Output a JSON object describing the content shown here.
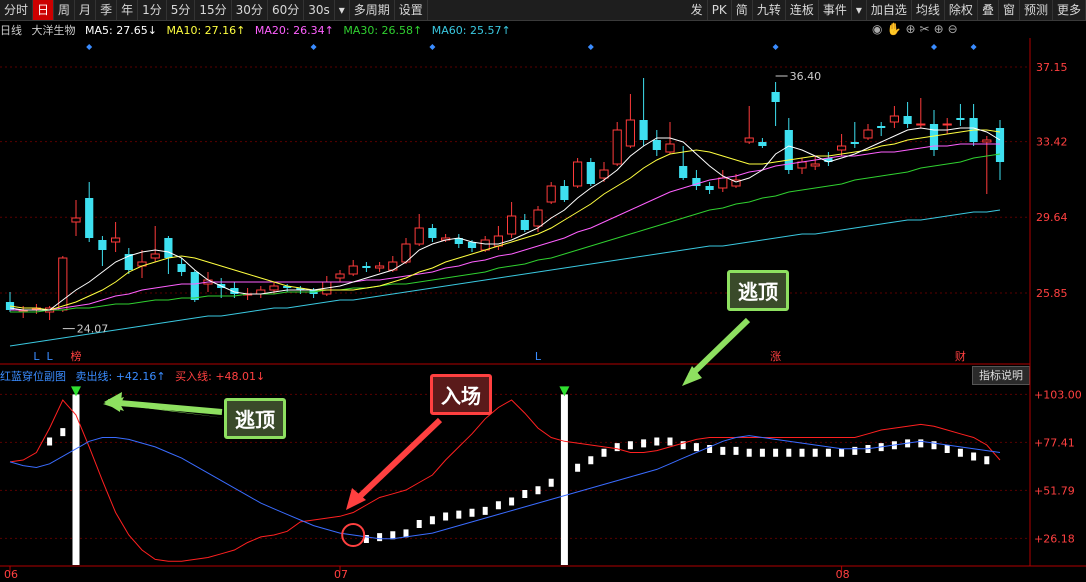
{
  "toolbar": {
    "left_items": [
      "分时",
      "日",
      "周",
      "月",
      "季",
      "年",
      "1分",
      "5分",
      "15分",
      "30分",
      "60分",
      "30s",
      "▾",
      "多周期",
      "设置"
    ],
    "active_index": 1,
    "right_items": [
      "发",
      "PK",
      "简",
      "九转",
      "连板",
      "事件",
      "▾",
      "加自选",
      "均线",
      "除权",
      "叠",
      "窗",
      "预测",
      "更多"
    ]
  },
  "info": {
    "period": "日线",
    "name": "大洋生物",
    "ma5": "MA5: 27.65↓",
    "ma10": "MA10: 27.16↑",
    "ma20": "MA20: 26.34↑",
    "ma30": "MA30: 26.58↑",
    "ma60": "MA60: 25.57↑"
  },
  "sub": {
    "title": "红蓝穿位副图",
    "sell": "卖出线: +42.16↑",
    "buy": "买入线: +48.01↓",
    "indicator_button": "指标说明"
  },
  "annotations": {
    "escape_top_1": "逃顶",
    "escape_top_2": "逃顶",
    "entry": "入场",
    "high_label": "36.40",
    "low_label": "24.07",
    "markers": [
      "L",
      "L",
      "榜",
      "L",
      "涨",
      "财"
    ]
  },
  "x_labels": [
    "06",
    "07",
    "08"
  ],
  "colors": {
    "up": "#ff3b3b",
    "down": "#3ee0f0",
    "ma5": "#ffffff",
    "ma10": "#ffff40",
    "ma20": "#ff60ff",
    "ma30": "#30d030",
    "ma60": "#3ac8e0",
    "red_line": "#ff2020",
    "blue_line": "#3a6cff",
    "callout_green": "#8ee060",
    "callout_red": "#ff4040"
  },
  "chart_data": [
    {
      "type": "candlestick",
      "title": "大洋生物 日线",
      "y_ticks": [
        37.15,
        33.42,
        29.64,
        25.85
      ],
      "ylim": [
        23.0,
        38.5
      ],
      "candles": [
        [
          25.4,
          25.0,
          25.9,
          24.9
        ],
        [
          25.0,
          25.0,
          25.2,
          24.6
        ],
        [
          25.1,
          25.1,
          25.3,
          24.8
        ],
        [
          24.9,
          25.1,
          25.2,
          24.5
        ],
        [
          25.0,
          27.6,
          27.7,
          24.9
        ],
        [
          29.4,
          29.6,
          30.5,
          28.7
        ],
        [
          30.6,
          28.6,
          31.4,
          28.4
        ],
        [
          28.5,
          28.0,
          28.7,
          27.2
        ],
        [
          28.4,
          28.6,
          29.4,
          27.9
        ],
        [
          27.8,
          27.0,
          28.1,
          26.8
        ],
        [
          27.2,
          27.4,
          28.0,
          26.6
        ],
        [
          27.6,
          27.8,
          29.2,
          27.4
        ],
        [
          28.6,
          27.6,
          28.7,
          26.8
        ],
        [
          27.3,
          26.9,
          27.6,
          26.7
        ],
        [
          26.9,
          25.5,
          27.0,
          25.4
        ],
        [
          26.3,
          26.5,
          26.9,
          25.9
        ],
        [
          26.3,
          26.1,
          26.6,
          25.6
        ],
        [
          26.1,
          25.8,
          26.4,
          25.6
        ],
        [
          25.8,
          25.8,
          26.1,
          25.5
        ],
        [
          25.8,
          26.0,
          26.2,
          25.6
        ],
        [
          26.0,
          26.2,
          26.4,
          25.8
        ],
        [
          26.2,
          26.1,
          26.3,
          25.9
        ],
        [
          26.1,
          26.0,
          26.2,
          25.8
        ],
        [
          26.0,
          25.8,
          26.1,
          25.6
        ],
        [
          25.8,
          26.4,
          26.7,
          25.7
        ],
        [
          26.6,
          26.8,
          27.0,
          26.4
        ],
        [
          26.8,
          27.2,
          27.5,
          26.7
        ],
        [
          27.2,
          27.1,
          27.4,
          26.9
        ],
        [
          27.1,
          27.2,
          27.4,
          26.9
        ],
        [
          27.0,
          27.4,
          27.7,
          26.9
        ],
        [
          27.4,
          28.3,
          28.6,
          27.3
        ],
        [
          28.3,
          29.1,
          29.8,
          28.2
        ],
        [
          29.1,
          28.6,
          29.3,
          28.4
        ],
        [
          28.5,
          28.6,
          28.8,
          28.4
        ],
        [
          28.6,
          28.3,
          28.8,
          28.1
        ],
        [
          28.4,
          28.1,
          28.5,
          27.9
        ],
        [
          28.0,
          28.5,
          28.7,
          27.9
        ],
        [
          28.2,
          28.7,
          29.2,
          28.0
        ],
        [
          28.8,
          29.7,
          30.4,
          28.6
        ],
        [
          29.5,
          29.0,
          29.8,
          28.9
        ],
        [
          29.2,
          30.0,
          30.2,
          28.9
        ],
        [
          30.4,
          31.2,
          31.4,
          30.3
        ],
        [
          31.2,
          30.5,
          31.5,
          30.4
        ],
        [
          31.2,
          32.4,
          32.6,
          31.1
        ],
        [
          32.4,
          31.3,
          32.6,
          31.2
        ],
        [
          31.6,
          32.0,
          32.4,
          31.4
        ],
        [
          32.3,
          34.0,
          34.4,
          32.2
        ],
        [
          33.2,
          34.5,
          35.8,
          33.1
        ],
        [
          34.5,
          33.5,
          36.6,
          33.2
        ],
        [
          33.5,
          33.0,
          34.0,
          32.7
        ],
        [
          32.9,
          33.3,
          34.4,
          32.8
        ],
        [
          32.2,
          31.6,
          33.2,
          31.5
        ],
        [
          31.6,
          31.2,
          32.0,
          31.0
        ],
        [
          31.2,
          31.0,
          31.4,
          30.8
        ],
        [
          31.1,
          31.6,
          32.0,
          30.9
        ],
        [
          31.2,
          31.5,
          31.8,
          31.1
        ],
        [
          33.4,
          33.6,
          35.2,
          33.3
        ],
        [
          33.4,
          33.2,
          33.6,
          33.1
        ],
        [
          35.9,
          35.4,
          36.4,
          34.2
        ],
        [
          34.0,
          32.0,
          34.6,
          31.8
        ],
        [
          32.1,
          32.4,
          32.6,
          31.8
        ],
        [
          32.2,
          32.3,
          32.7,
          32.0
        ],
        [
          32.6,
          32.4,
          32.9,
          32.2
        ],
        [
          33.0,
          33.2,
          33.8,
          32.7
        ],
        [
          33.4,
          33.3,
          34.4,
          33.1
        ],
        [
          33.6,
          34.0,
          34.3,
          33.5
        ],
        [
          34.2,
          34.1,
          34.4,
          33.7
        ],
        [
          34.4,
          34.7,
          35.2,
          34.1
        ],
        [
          34.7,
          34.3,
          35.4,
          34.1
        ],
        [
          34.3,
          34.3,
          35.6,
          34.1
        ],
        [
          34.3,
          33.0,
          35.0,
          32.7
        ],
        [
          34.3,
          34.3,
          34.6,
          33.8
        ],
        [
          34.6,
          34.5,
          35.3,
          34.2
        ],
        [
          34.6,
          33.4,
          35.3,
          33.2
        ],
        [
          33.4,
          33.5,
          33.7,
          30.8
        ],
        [
          34.1,
          32.4,
          34.5,
          31.5
        ]
      ],
      "ma5": [
        25.1,
        25.0,
        25.0,
        25.0,
        25.5,
        26.0,
        26.4,
        26.9,
        27.4,
        27.7,
        27.9,
        28.0,
        27.9,
        27.6,
        27.0,
        26.5,
        26.2,
        25.9,
        25.8,
        25.8,
        25.9,
        26.0,
        26.0,
        26.0,
        26.1,
        26.2,
        26.4,
        26.6,
        26.8,
        27.0,
        27.4,
        28.0,
        28.3,
        28.5,
        28.6,
        28.4,
        28.3,
        28.3,
        28.5,
        28.8,
        29.1,
        29.6,
        30.0,
        30.6,
        31.1,
        31.5,
        32.0,
        32.7,
        33.2,
        33.6,
        33.6,
        33.4,
        32.8,
        32.2,
        31.7,
        31.4,
        31.6,
        32.0,
        32.8,
        33.2,
        33.0,
        32.7,
        32.4,
        32.6,
        32.8,
        33.1,
        33.4,
        33.7,
        34.0,
        34.1,
        34.0,
        34.0,
        34.1,
        34.1,
        33.9,
        33.5
      ],
      "ma10": [
        25.2,
        25.1,
        25.1,
        25.0,
        25.2,
        25.4,
        25.7,
        26.0,
        26.4,
        26.9,
        27.2,
        27.4,
        27.6,
        27.7,
        27.6,
        27.4,
        27.2,
        27.0,
        26.8,
        26.6,
        26.4,
        26.2,
        26.1,
        26.0,
        26.0,
        26.0,
        26.0,
        26.1,
        26.2,
        26.4,
        26.6,
        26.9,
        27.1,
        27.4,
        27.6,
        27.8,
        28.0,
        28.2,
        28.4,
        28.6,
        28.8,
        29.1,
        29.5,
        29.9,
        30.3,
        30.8,
        31.2,
        31.6,
        32.1,
        32.5,
        32.8,
        32.9,
        33.0,
        32.9,
        32.7,
        32.5,
        32.3,
        32.3,
        32.4,
        32.5,
        32.6,
        32.7,
        32.7,
        32.8,
        32.9,
        33.0,
        33.2,
        33.3,
        33.5,
        33.6,
        33.7,
        33.8,
        33.9,
        34.0,
        34.0,
        33.9
      ],
      "ma20": [
        25.0,
        25.0,
        25.0,
        25.0,
        25.1,
        25.2,
        25.3,
        25.5,
        25.7,
        25.8,
        26.0,
        26.1,
        26.2,
        26.3,
        26.3,
        26.4,
        26.4,
        26.4,
        26.4,
        26.4,
        26.4,
        26.4,
        26.4,
        26.4,
        26.4,
        26.4,
        26.4,
        26.5,
        26.5,
        26.6,
        26.7,
        26.8,
        26.9,
        27.1,
        27.2,
        27.4,
        27.5,
        27.7,
        27.8,
        28.0,
        28.2,
        28.4,
        28.6,
        28.9,
        29.1,
        29.4,
        29.7,
        30.0,
        30.3,
        30.6,
        30.9,
        31.1,
        31.3,
        31.5,
        31.6,
        31.7,
        31.9,
        32.0,
        32.2,
        32.3,
        32.4,
        32.5,
        32.6,
        32.7,
        32.7,
        32.8,
        32.9,
        32.9,
        33.0,
        33.1,
        33.2,
        33.2,
        33.3,
        33.3,
        33.3,
        33.3
      ],
      "ma30": [
        24.9,
        24.9,
        24.9,
        25.0,
        25.0,
        25.1,
        25.1,
        25.2,
        25.3,
        25.3,
        25.4,
        25.5,
        25.5,
        25.6,
        25.6,
        25.7,
        25.7,
        25.7,
        25.8,
        25.8,
        25.8,
        25.9,
        25.9,
        25.9,
        26.0,
        26.0,
        26.1,
        26.1,
        26.2,
        26.3,
        26.3,
        26.4,
        26.5,
        26.6,
        26.7,
        26.8,
        26.9,
        27.1,
        27.2,
        27.3,
        27.5,
        27.6,
        27.8,
        28.0,
        28.2,
        28.4,
        28.6,
        28.8,
        29.0,
        29.2,
        29.4,
        29.6,
        29.8,
        30.0,
        30.1,
        30.3,
        30.4,
        30.6,
        30.7,
        30.9,
        31.0,
        31.1,
        31.2,
        31.3,
        31.5,
        31.6,
        31.7,
        31.8,
        31.9,
        32.1,
        32.2,
        32.3,
        32.4,
        32.6,
        32.7,
        32.8
      ],
      "ma60": [
        23.2,
        23.3,
        23.4,
        23.5,
        23.6,
        23.7,
        23.8,
        23.9,
        24.0,
        24.1,
        24.2,
        24.3,
        24.4,
        24.5,
        24.6,
        24.7,
        24.7,
        24.8,
        24.9,
        25.0,
        25.1,
        25.1,
        25.2,
        25.3,
        25.4,
        25.5,
        25.5,
        25.6,
        25.7,
        25.8,
        25.9,
        26.0,
        26.1,
        26.2,
        26.3,
        26.4,
        26.5,
        26.6,
        26.7,
        26.8,
        26.9,
        27.0,
        27.1,
        27.2,
        27.3,
        27.4,
        27.5,
        27.6,
        27.7,
        27.8,
        27.9,
        28.0,
        28.1,
        28.2,
        28.2,
        28.3,
        28.4,
        28.5,
        28.6,
        28.7,
        28.8,
        28.8,
        28.9,
        29.0,
        29.1,
        29.2,
        29.3,
        29.4,
        29.5,
        29.5,
        29.6,
        29.7,
        29.8,
        29.9,
        29.9,
        30.0
      ]
    },
    {
      "type": "line",
      "title": "红蓝穿位副图",
      "y_ticks": [
        103.0,
        77.41,
        51.79,
        26.18
      ],
      "ylim": [
        12,
        108
      ],
      "series": [
        {
          "name": "卖出线",
          "values": [
            67,
            65,
            64,
            66,
            70,
            74,
            78,
            80,
            80,
            79,
            77,
            75,
            72,
            69,
            65,
            61,
            57,
            53,
            49,
            45,
            42,
            39,
            36,
            33,
            31,
            29,
            28,
            27,
            26,
            26,
            27,
            28,
            29,
            31,
            33,
            35,
            37,
            39,
            41,
            43,
            45,
            47,
            49,
            51,
            53,
            55,
            57,
            59,
            61,
            63,
            66,
            69,
            72,
            75,
            78,
            80,
            81,
            80,
            79,
            78,
            77,
            76,
            75,
            74,
            74,
            74,
            75,
            76,
            77,
            78,
            77,
            76,
            75,
            74,
            73,
            72
          ]
        },
        {
          "name": "买入线",
          "values": [
            67,
            68,
            72,
            85,
            100,
            92,
            75,
            57,
            40,
            28,
            20,
            15,
            14,
            14,
            15,
            16,
            18,
            20,
            24,
            27,
            28,
            30,
            35,
            36,
            37,
            38,
            40,
            44,
            48,
            50,
            52,
            56,
            60,
            68,
            75,
            82,
            90,
            96,
            100,
            93,
            85,
            80,
            78,
            77,
            76,
            75,
            74,
            72,
            72,
            73,
            75,
            77,
            79,
            80,
            80,
            80,
            80,
            80,
            80,
            80,
            80,
            80,
            80,
            80,
            80,
            82,
            84,
            85,
            86,
            87,
            86,
            84,
            82,
            80,
            76,
            68
          ]
        }
      ],
      "bars": [
        0,
        0,
        0,
        80,
        85,
        100,
        0,
        0,
        0,
        0,
        0,
        0,
        0,
        0,
        0,
        0,
        0,
        0,
        0,
        0,
        0,
        0,
        0,
        0,
        0,
        0,
        0,
        28,
        29,
        30,
        31,
        36,
        38,
        40,
        41,
        42,
        43,
        46,
        48,
        52,
        54,
        58,
        62,
        66,
        70,
        74,
        77,
        78,
        79,
        80,
        80,
        78,
        77,
        76,
        75,
        75,
        74,
        74,
        74,
        74,
        74,
        74,
        74,
        74,
        75,
        76,
        77,
        78,
        79,
        79,
        78,
        76,
        74,
        72,
        70,
        0
      ],
      "escape_signals": [
        5,
        42
      ],
      "entry_index": 26
    }
  ]
}
